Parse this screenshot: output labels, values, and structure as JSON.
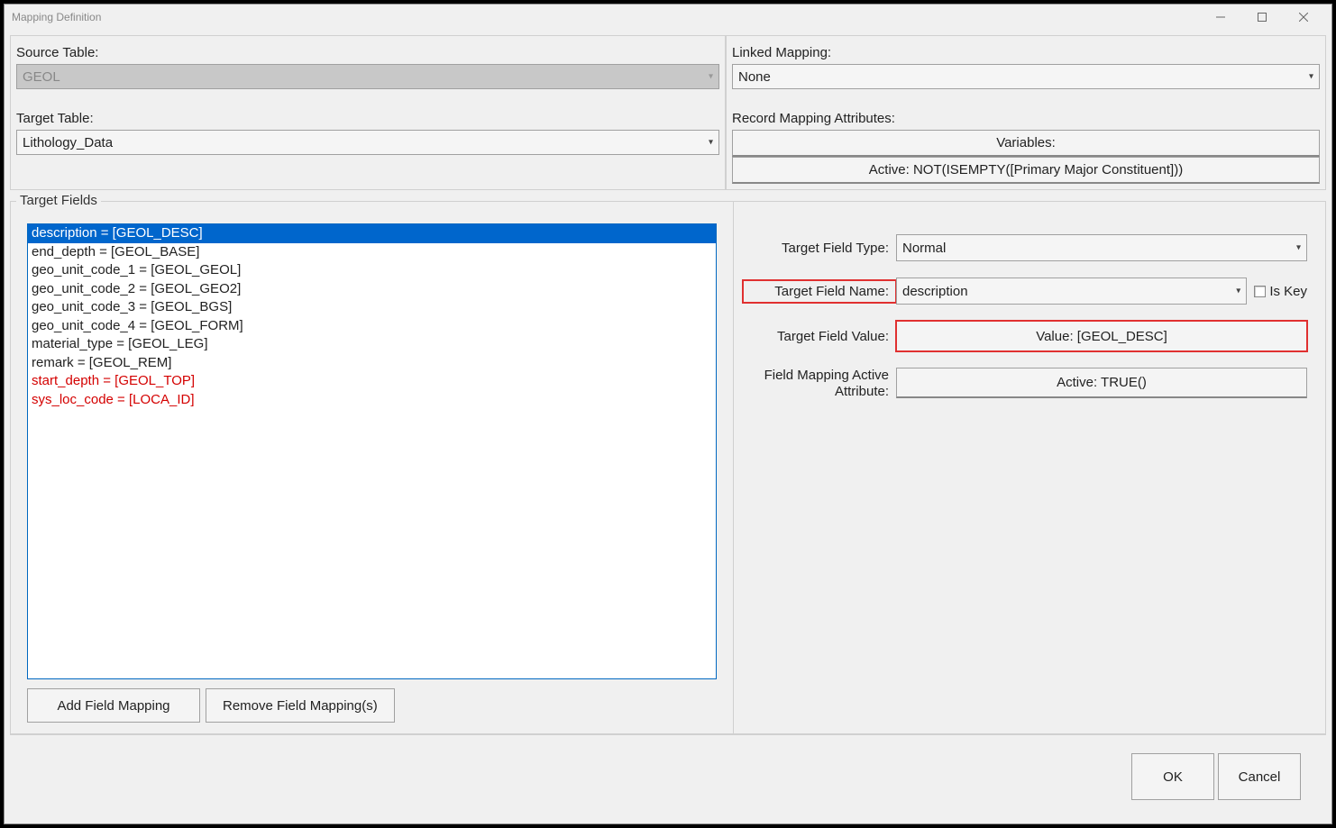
{
  "window": {
    "title": "Mapping Definition"
  },
  "source_table": {
    "label": "Source Table:",
    "value": "GEOL"
  },
  "target_table": {
    "label": "Target Table:",
    "value": "Lithology_Data"
  },
  "linked_mapping": {
    "label": "Linked Mapping:",
    "value": "None"
  },
  "record_attrs": {
    "label": "Record Mapping Attributes:",
    "variables_btn": "Variables:",
    "active_btn": "Active: NOT(ISEMPTY([Primary Major Constituent]))"
  },
  "target_fields": {
    "legend": "Target Fields",
    "items": [
      {
        "text": "description = [GEOL_DESC]",
        "selected": true,
        "red": false
      },
      {
        "text": "end_depth = [GEOL_BASE]",
        "selected": false,
        "red": false
      },
      {
        "text": "geo_unit_code_1 = [GEOL_GEOL]",
        "selected": false,
        "red": false
      },
      {
        "text": "geo_unit_code_2 = [GEOL_GEO2]",
        "selected": false,
        "red": false
      },
      {
        "text": "geo_unit_code_3 = [GEOL_BGS]",
        "selected": false,
        "red": false
      },
      {
        "text": "geo_unit_code_4 = [GEOL_FORM]",
        "selected": false,
        "red": false
      },
      {
        "text": "material_type = [GEOL_LEG]",
        "selected": false,
        "red": false
      },
      {
        "text": "remark = [GEOL_REM]",
        "selected": false,
        "red": false
      },
      {
        "text": "start_depth = [GEOL_TOP]",
        "selected": false,
        "red": true
      },
      {
        "text": "sys_loc_code = [LOCA_ID]",
        "selected": false,
        "red": true
      }
    ],
    "add_btn": "Add Field Mapping",
    "remove_btn": "Remove Field Mapping(s)"
  },
  "detail": {
    "field_type": {
      "label": "Target Field Type:",
      "value": "Normal"
    },
    "field_name": {
      "label": "Target Field Name:",
      "value": "description",
      "is_key_label": "Is Key"
    },
    "field_value": {
      "label": "Target Field Value:",
      "value": "Value: [GEOL_DESC]"
    },
    "active_attr": {
      "label1": "Field Mapping Active",
      "label2": "Attribute:",
      "value": "Active: TRUE()"
    }
  },
  "footer": {
    "ok": "OK",
    "cancel": "Cancel"
  }
}
